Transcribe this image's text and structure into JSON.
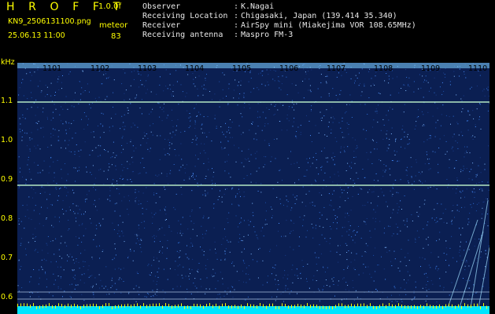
{
  "header": {
    "app_title": "H R O F F T",
    "version": "1.0.0f",
    "filename": "KN9_2506131100.png",
    "meteor_label": "meteor",
    "timestamp": "25.06.13 11:00",
    "meteor_count": "83"
  },
  "meta": [
    {
      "label": "Observer",
      "value": "K.Nagai"
    },
    {
      "label": "Receiving Location",
      "value": "Chigasaki, Japan (139.414 35.340)"
    },
    {
      "label": "Receiver",
      "value": "AirSpy mini (Miakejima VOR 108.65MHz)"
    },
    {
      "label": "Receiving antenna",
      "value": "Maspro FM-3"
    }
  ],
  "meta_separator": ":",
  "plot": {
    "y_unit": "kHz",
    "y_ticks": [
      "1.1",
      "1.0",
      "0.9",
      "0.8",
      "0.7",
      "0.6"
    ],
    "x_ticks": [
      "1101",
      "1102",
      "1103",
      "1104",
      "1105",
      "1106",
      "1107",
      "1108",
      "1109",
      "1110"
    ]
  },
  "colors": {
    "background": "#000000",
    "label": "#ffff00",
    "meta_text": "#e8e8e8",
    "spectrogram_bg": "#0b1f52",
    "signal_line": "#c8ffd0",
    "noise_floor": "#00e5ff"
  }
}
